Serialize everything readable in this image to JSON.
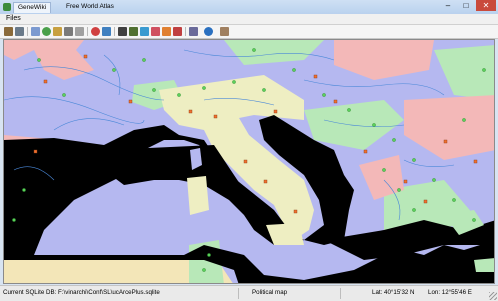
{
  "window": {
    "tabs": [
      "GeneWiki",
      "Free World Atlas"
    ],
    "controls": [
      "–",
      "□",
      "✕"
    ]
  },
  "menu": {
    "file": "Files"
  },
  "toolbar": {
    "tools": [
      "pencil-icon",
      "pencil-alt-icon",
      "settings-icon",
      "globe-icon",
      "layers-icon",
      "gear-icon",
      "table-icon",
      "palette-icon",
      "layer-icon",
      "grid-icon",
      "map-icon",
      "pin-icon",
      "bookmark-icon",
      "search-icon",
      "tag-icon",
      "help-icon",
      "info-icon",
      "close-icon"
    ]
  },
  "map": {
    "view": "Political map",
    "region": "Europe / Mediterranean",
    "colors": {
      "sea": "#000000",
      "land_purple": "#b5b8f0",
      "land_pink": "#f3b8b8",
      "land_green": "#b8e8b8",
      "land_yellow": "#eeeec2",
      "land_tan": "#f3e6b8",
      "rivers": "#4a88d8",
      "cities": "#f07030",
      "places": "#5ad05a"
    }
  },
  "status": {
    "db": "Current SQLite DB: F:\\vinarchi\\Conf\\SL\\ucArcePlus.sqlite",
    "view": "Political map",
    "lat": "Lat: 40°15'32 N",
    "lon": "Lon: 12°55'46 E"
  }
}
